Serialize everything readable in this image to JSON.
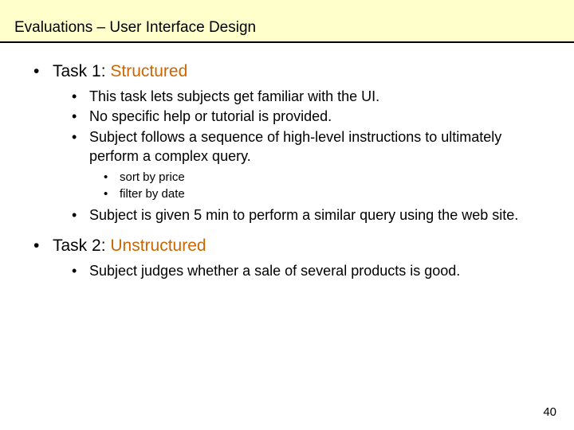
{
  "title": "Evaluations – User Interface Design",
  "task1": {
    "prefix": "Task 1: ",
    "label": "Structured",
    "bullets": [
      "This task lets subjects get familiar with the UI.",
      "No specific help or tutorial is provided.",
      "Subject follows a sequence of high-level instructions to ultimately perform a complex query."
    ],
    "subbullets": [
      "sort by price",
      "filter by date"
    ],
    "bullets2": [
      "Subject is given 5 min to perform a similar query using the web site."
    ]
  },
  "task2": {
    "prefix": "Task 2: ",
    "label": "Unstructured",
    "bullets": [
      "Subject judges whether a sale of several products is good."
    ]
  },
  "page": "40",
  "glyphs": {
    "dot": "•"
  }
}
